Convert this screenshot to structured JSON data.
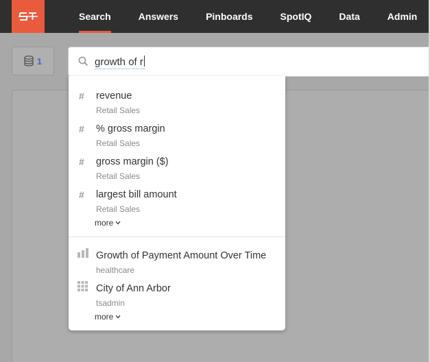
{
  "nav": {
    "logo_icon": "thoughtspot-logo-icon",
    "items": [
      {
        "label": "Search",
        "active": true
      },
      {
        "label": "Answers",
        "active": false
      },
      {
        "label": "Pinboards",
        "active": false
      },
      {
        "label": "SpotIQ",
        "active": false
      },
      {
        "label": "Data",
        "active": false
      },
      {
        "label": "Admin",
        "active": false
      }
    ]
  },
  "sources": {
    "icon": "database-icon",
    "count": "1"
  },
  "search": {
    "icon": "search-icon",
    "value": "growth of r"
  },
  "column_suggestions": [
    {
      "icon": "hash-icon",
      "title": "revenue",
      "source": "Retail Sales"
    },
    {
      "icon": "hash-icon",
      "title": "% gross margin",
      "source": "Retail Sales"
    },
    {
      "icon": "hash-icon",
      "title": "gross margin ($)",
      "source": "Retail Sales"
    },
    {
      "icon": "hash-icon",
      "title": "largest bill amount",
      "source": "Retail Sales"
    }
  ],
  "column_more": "more",
  "object_suggestions": [
    {
      "icon": "bar-chart-icon",
      "title": "Growth of Payment Amount Over Time",
      "source": "healthcare"
    },
    {
      "icon": "table-grid-icon",
      "title": "City of Ann Arbor",
      "source": "tsadmin"
    }
  ],
  "object_more": "more",
  "colors": {
    "brand": "#ea5a3d",
    "nav_bg": "#2f2f2f",
    "link": "#3a6fbf",
    "workspace": "#a8a8a8"
  }
}
